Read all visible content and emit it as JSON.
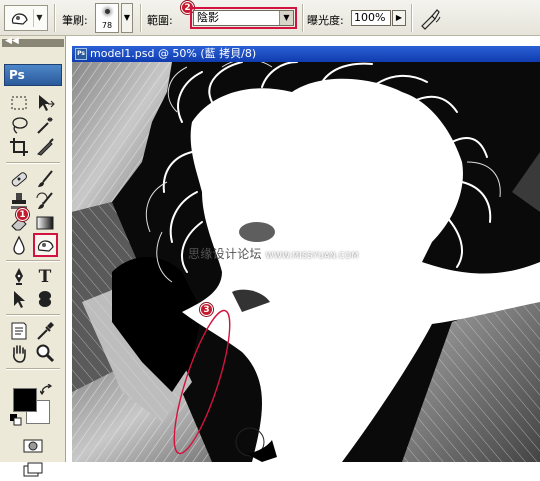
{
  "options_bar": {
    "brush_label": "筆刷:",
    "brush_size": "78",
    "range_label": "範圍:",
    "range_value": "陰影",
    "exposure_label": "曝光度:",
    "exposure_value": "100%"
  },
  "toolbox": {
    "logo": "Ps",
    "collapse_glyph": "◀◀"
  },
  "document": {
    "title": "model1.psd @ 50% (藍 拷貝/8)",
    "watermark_cn": "思缘设计论坛",
    "watermark_url": "WWW.MISSYUAN.COM"
  },
  "annotations": {
    "badge1": "1",
    "badge2": "2",
    "badge3": "3",
    "highlight_color": "#d3133f"
  },
  "colors": {
    "foreground": "#000000",
    "background": "#ffffff",
    "titlebar": "#1746c0"
  }
}
